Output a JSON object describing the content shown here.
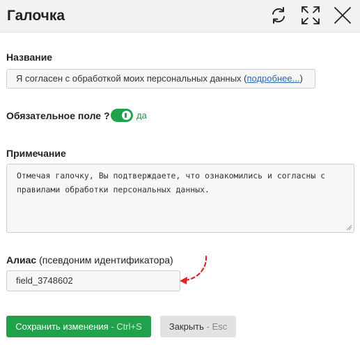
{
  "window": {
    "title": "Галочка",
    "icons": {
      "refresh": "refresh-icon",
      "expand": "expand-icon",
      "close": "close-icon"
    }
  },
  "name_field": {
    "label": "Название",
    "value_prefix": "Я согласен с обработкой моих персональных данных (",
    "link_text": "подробнее...",
    "value_suffix": ")"
  },
  "required_field": {
    "label": "Обязательное поле ?",
    "state_text": "да",
    "enabled": true,
    "color": "#1fa24b"
  },
  "note": {
    "label": "Примечание",
    "value": "Отмечая галочку, Вы подтверждаете, что ознакомились и согласны с\nправилами обработки персональных данных."
  },
  "alias": {
    "label": "Алиас",
    "label_hint": "(псевдоним идентификатора)",
    "value": "field_3748602"
  },
  "buttons": {
    "save_label": "Сохранить изменения",
    "save_hint": " - Ctrl+S",
    "close_label": "Закрыть",
    "close_hint": " - Esc"
  },
  "colors": {
    "accent": "#1fa24b",
    "arrow": "#d9262c",
    "link": "#2a6ab8"
  }
}
